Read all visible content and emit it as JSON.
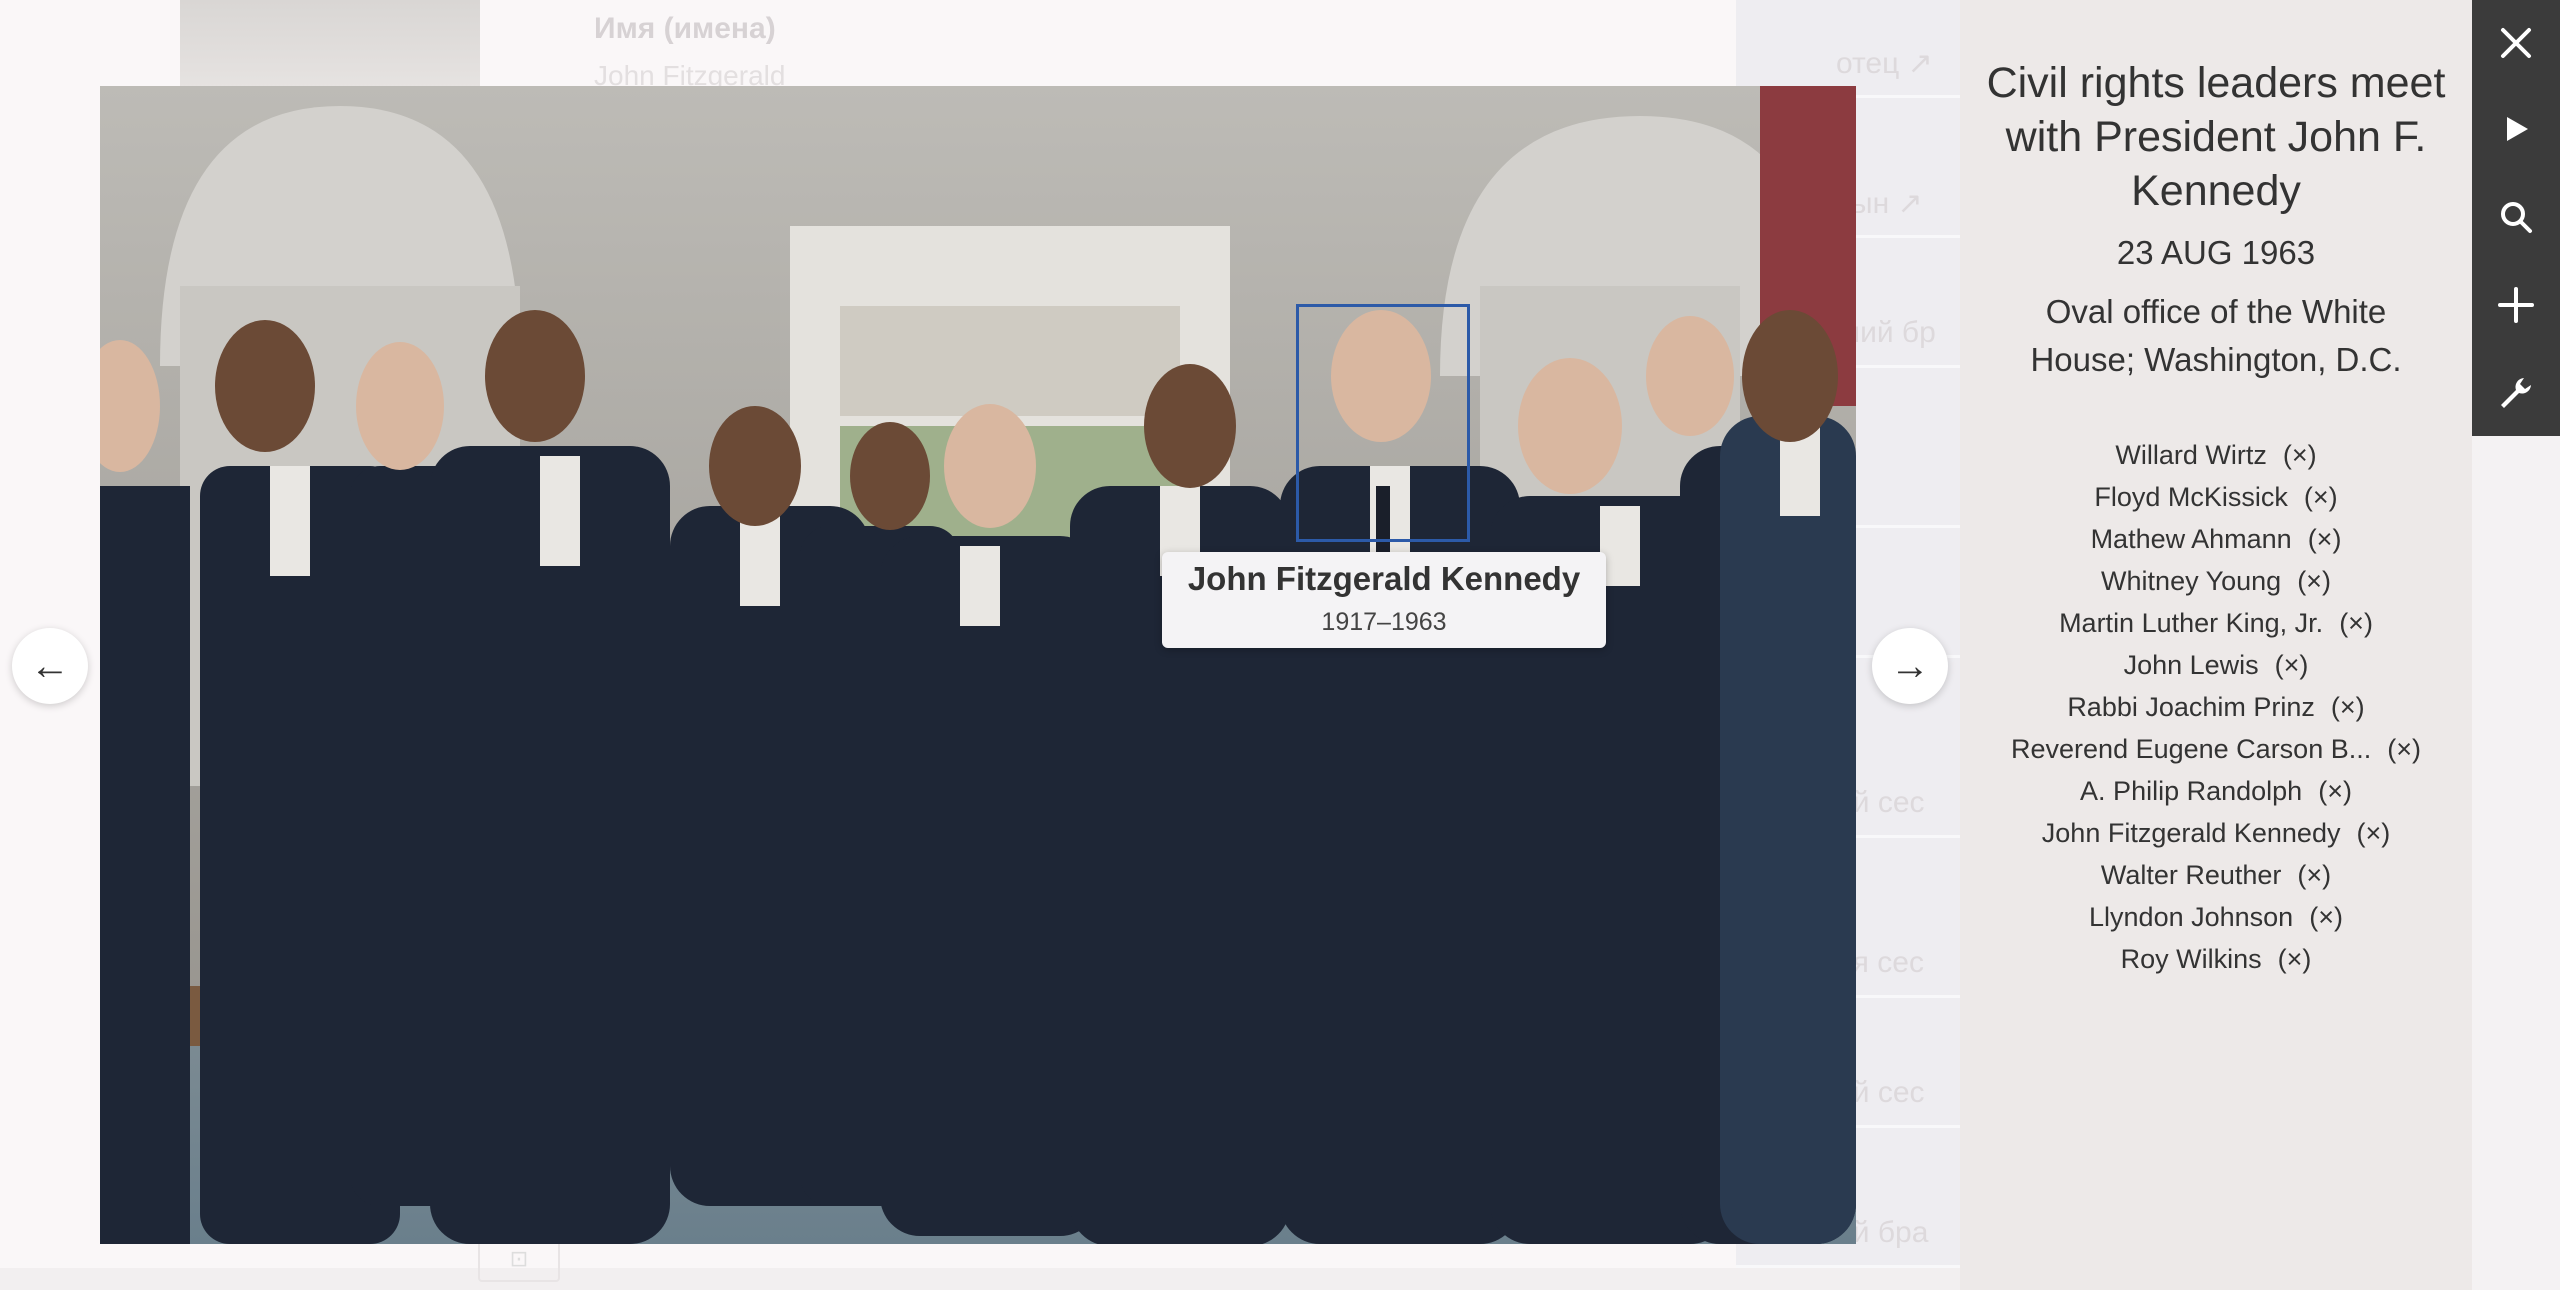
{
  "background": {
    "header_label": "Имя (имена)",
    "header_value": "John Fitzgerald",
    "right_rows": [
      "отец ↗",
      "сын ↗",
      "ший бр",
      "✓",
      "",
      "ий сес",
      "ая сес",
      "ий сес",
      "ий бра"
    ]
  },
  "photo": {
    "alt": "Civil rights leaders meet with President John F. Kennedy"
  },
  "tooltip": {
    "name": "John Fitzgerald Kennedy",
    "years": "1917–1963"
  },
  "nav": {
    "prev_icon": "arrow-left-icon",
    "next_icon": "arrow-right-icon",
    "prev_glyph": "←",
    "next_glyph": "→"
  },
  "info": {
    "title": "Civil rights leaders meet with President John F. Kennedy",
    "date": "23 AUG 1963",
    "place": "Oval office of the White House; Washington, D.C.",
    "remove_label": "(×)",
    "people": [
      "Willard Wirtz",
      "Floyd McKissick",
      "Mathew Ahmann",
      "Whitney Young",
      "Martin Luther King, Jr.",
      "John Lewis",
      "Rabbi Joachim Prinz",
      "Reverend Eugene Carson B...",
      "A. Philip Randolph",
      "John Fitzgerald Kennedy",
      "Walter Reuther",
      "Llyndon Johnson",
      "Roy Wilkins"
    ]
  },
  "toolbar": {
    "close_icon": "close-icon",
    "play_icon": "play-icon",
    "search_icon": "search-icon",
    "add_icon": "plus-icon",
    "tools_icon": "wrench-icon",
    "dark_color": "#3b3b3b"
  }
}
